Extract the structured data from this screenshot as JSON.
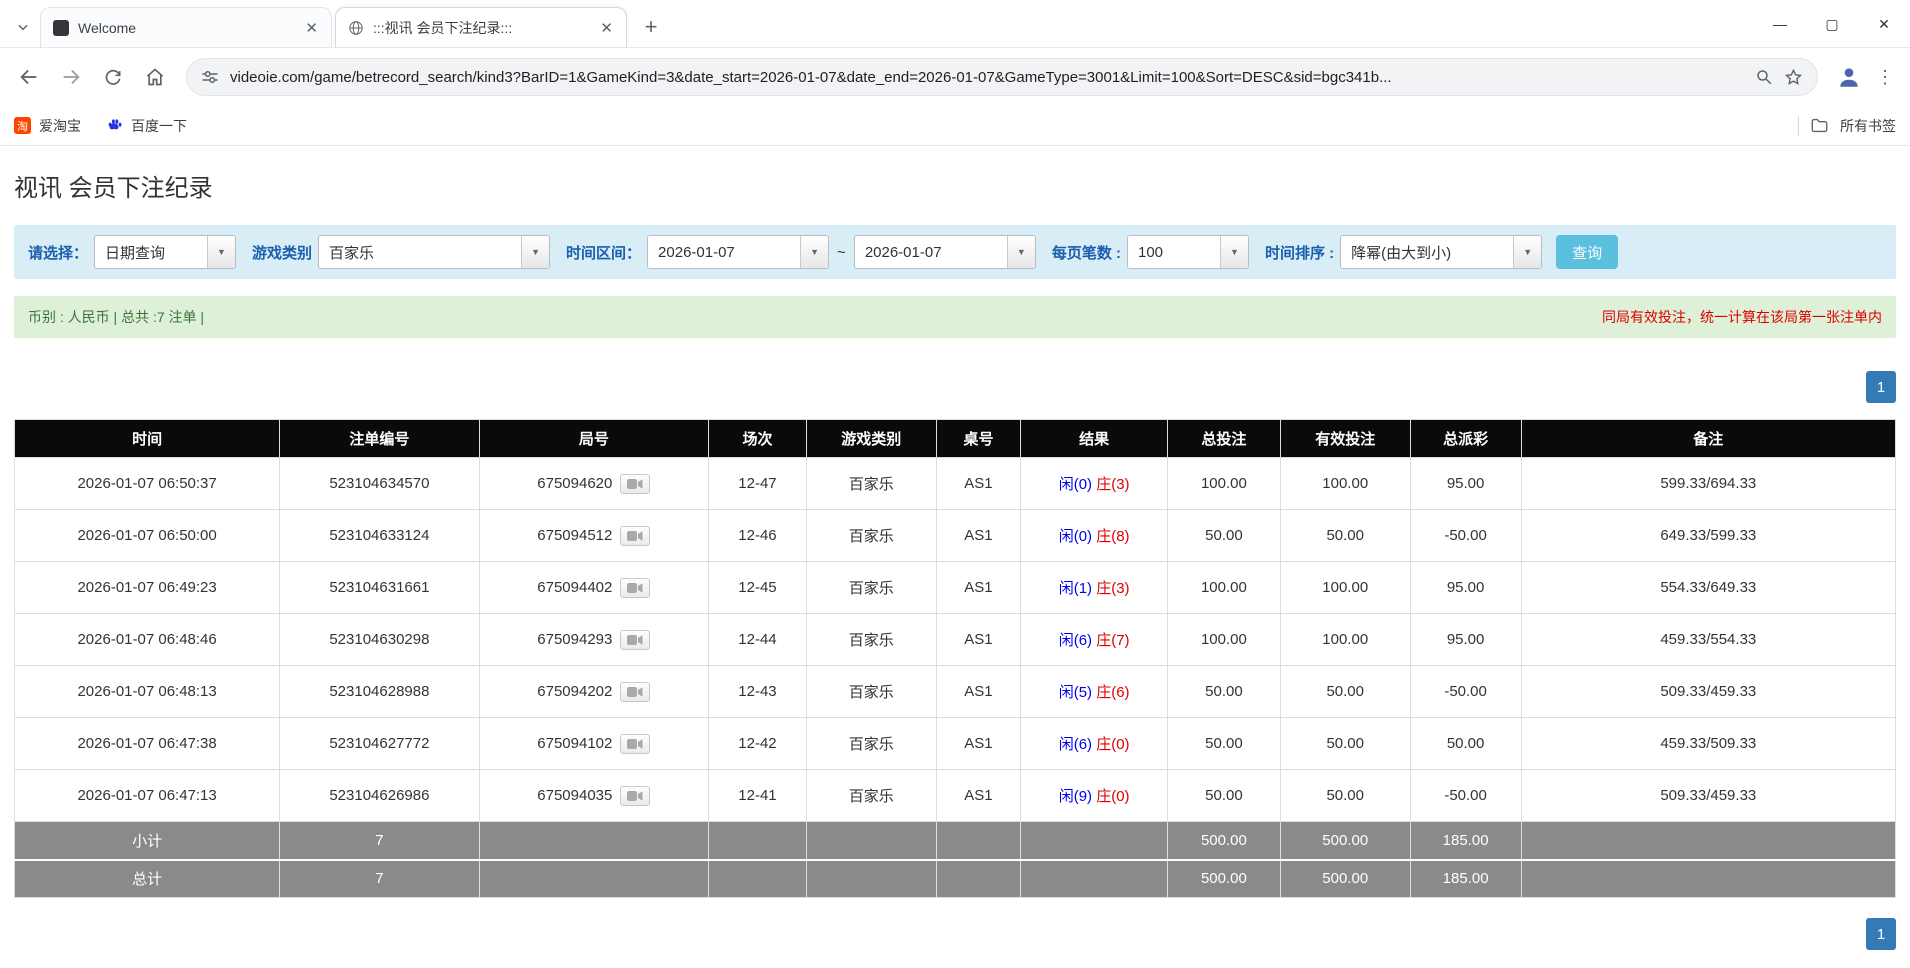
{
  "colors": {
    "accent_blue": "#337ab7",
    "button_cyan": "#5bc0de",
    "link_blue": "#0066cc",
    "negative_red": "#dd0000",
    "player_blue": "#0000ee",
    "banker_red": "#dd0000",
    "label_blue": "#1a5eae",
    "filter_bg": "#d9edf7",
    "summary_bg": "#dff0d8",
    "header_bg": "#0a0a0a",
    "footer_bg": "#8a8a8a"
  },
  "browser": {
    "tabs": [
      {
        "title": "Welcome"
      },
      {
        "title": ":::视讯 会员下注纪录:::"
      }
    ],
    "url": "videoie.com/game/betrecord_search/kind3?BarID=1&GameKind=3&date_start=2026-01-07&date_end=2026-01-07&GameType=3001&Limit=100&Sort=DESC&sid=bgc341b...",
    "bookmarks": [
      {
        "label": "爱淘宝",
        "badge": "淘"
      },
      {
        "label": "百度一下"
      }
    ],
    "all_bookmarks_label": "所有书签"
  },
  "page": {
    "title": "视讯 会员下注纪录",
    "filters": {
      "select_label": "请选择：",
      "select_value": "日期查询",
      "game_label": "游戏类别",
      "game_value": "百家乐",
      "range_label": "时间区间：",
      "date_start": "2026-01-07",
      "range_sep": "~",
      "date_end": "2026-01-07",
      "page_size_label": "每页笔数 :",
      "page_size_value": "100",
      "sort_label": "时间排序 :",
      "sort_value": "降幂(由大到小)",
      "search_button": "查询"
    },
    "summary": {
      "left": "币别 : 人民币 | 总共 :7 注单 |",
      "right": "同局有效投注，统一计算在该局第一张注单内"
    },
    "pagination": {
      "page": "1"
    },
    "table": {
      "headers": [
        "时间",
        "注单编号",
        "局号",
        "场次",
        "游戏类别",
        "桌号",
        "结果",
        "总投注",
        "有效投注",
        "总派彩",
        "备注"
      ],
      "rows": [
        {
          "time": "2026-01-07 06:50:37",
          "bet_id": "523104634570",
          "round_id": "675094620",
          "session": "12-47",
          "game": "百家乐",
          "table_no": "AS1",
          "player": "闲(0)",
          "banker": "庄(3)",
          "total_bet": "100.00",
          "valid_bet": "100.00",
          "payout": "95.00",
          "note": "599.33/694.33"
        },
        {
          "time": "2026-01-07 06:50:00",
          "bet_id": "523104633124",
          "round_id": "675094512",
          "session": "12-46",
          "game": "百家乐",
          "table_no": "AS1",
          "player": "闲(0)",
          "banker": "庄(8)",
          "total_bet": "50.00",
          "valid_bet": "50.00",
          "payout": "-50.00",
          "note": "649.33/599.33"
        },
        {
          "time": "2026-01-07 06:49:23",
          "bet_id": "523104631661",
          "round_id": "675094402",
          "session": "12-45",
          "game": "百家乐",
          "table_no": "AS1",
          "player": "闲(1)",
          "banker": "庄(3)",
          "total_bet": "100.00",
          "valid_bet": "100.00",
          "payout": "95.00",
          "note": "554.33/649.33"
        },
        {
          "time": "2026-01-07 06:48:46",
          "bet_id": "523104630298",
          "round_id": "675094293",
          "session": "12-44",
          "game": "百家乐",
          "table_no": "AS1",
          "player": "闲(6)",
          "banker": "庄(7)",
          "total_bet": "100.00",
          "valid_bet": "100.00",
          "payout": "95.00",
          "note": "459.33/554.33"
        },
        {
          "time": "2026-01-07 06:48:13",
          "bet_id": "523104628988",
          "round_id": "675094202",
          "session": "12-43",
          "game": "百家乐",
          "table_no": "AS1",
          "player": "闲(5)",
          "banker": "庄(6)",
          "total_bet": "50.00",
          "valid_bet": "50.00",
          "payout": "-50.00",
          "note": "509.33/459.33"
        },
        {
          "time": "2026-01-07 06:47:38",
          "bet_id": "523104627772",
          "round_id": "675094102",
          "session": "12-42",
          "game": "百家乐",
          "table_no": "AS1",
          "player": "闲(6)",
          "banker": "庄(0)",
          "total_bet": "50.00",
          "valid_bet": "50.00",
          "payout": "50.00",
          "note": "459.33/509.33"
        },
        {
          "time": "2026-01-07 06:47:13",
          "bet_id": "523104626986",
          "round_id": "675094035",
          "session": "12-41",
          "game": "百家乐",
          "table_no": "AS1",
          "player": "闲(9)",
          "banker": "庄(0)",
          "total_bet": "50.00",
          "valid_bet": "50.00",
          "payout": "-50.00",
          "note": "509.33/459.33"
        }
      ],
      "subtotal": {
        "label": "小计",
        "count": "7",
        "total_bet": "500.00",
        "valid_bet": "500.00",
        "payout": "185.00"
      },
      "grand_total": {
        "label": "总计",
        "count": "7",
        "total_bet": "500.00",
        "valid_bet": "500.00",
        "payout": "185.00"
      }
    }
  }
}
